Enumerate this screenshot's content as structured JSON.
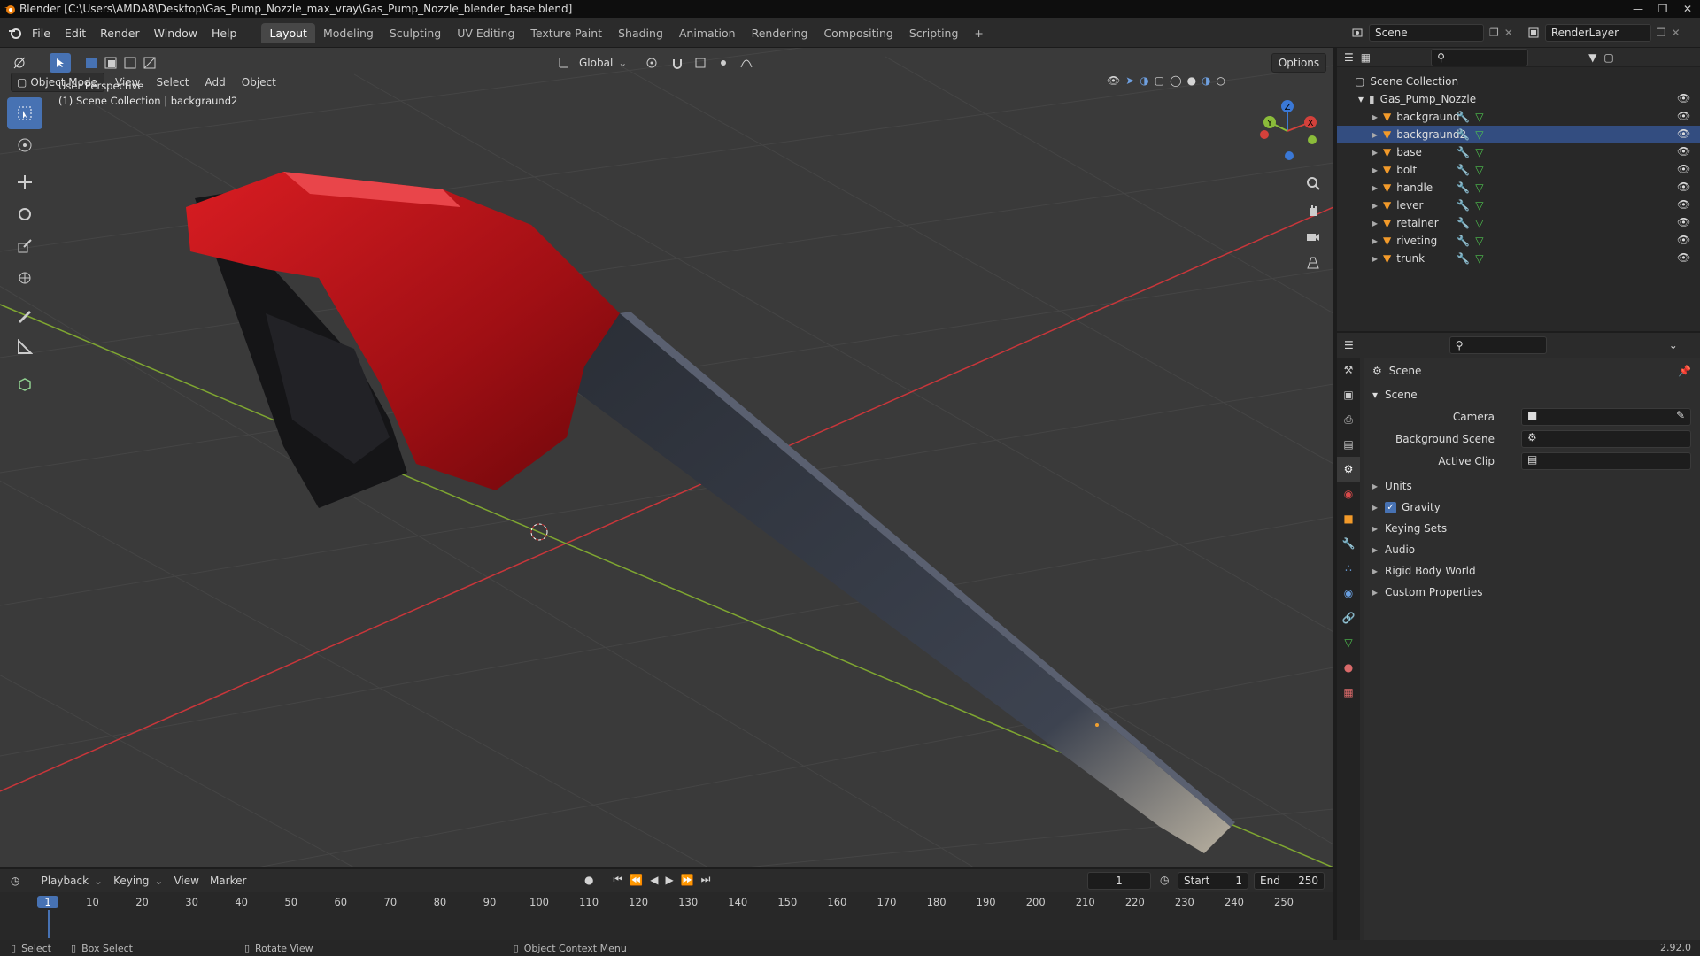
{
  "titlebar": {
    "title": "Blender [C:\\Users\\AMDA8\\Desktop\\Gas_Pump_Nozzle_max_vray\\Gas_Pump_Nozzle_blender_base.blend]"
  },
  "menu": [
    "File",
    "Edit",
    "Render",
    "Window",
    "Help"
  ],
  "workspaces": [
    "Layout",
    "Modeling",
    "Sculpting",
    "UV Editing",
    "Texture Paint",
    "Shading",
    "Animation",
    "Rendering",
    "Compositing",
    "Scripting"
  ],
  "active_workspace": "Layout",
  "topbar": {
    "orientation": "Global",
    "options": "Options"
  },
  "scene_selector": {
    "scene": "Scene",
    "view_layer": "RenderLayer"
  },
  "viewport": {
    "mode": "Object Mode",
    "menus": [
      "View",
      "Select",
      "Add",
      "Object"
    ],
    "overlay_text_1": "User Perspective",
    "overlay_text_2": "(1) Scene Collection | backgraund2",
    "gizmo": {
      "x": "X",
      "y": "Y",
      "z": "Z"
    }
  },
  "outliner": {
    "root": "Scene Collection",
    "collection": "Gas_Pump_Nozzle",
    "objects": [
      "backgraund",
      "backgraund2",
      "base",
      "bolt",
      "handle",
      "lever",
      "retainer",
      "riveting",
      "trunk"
    ],
    "selected": "backgraund2"
  },
  "properties": {
    "context": "Scene",
    "panel_title": "Scene",
    "fields": [
      {
        "label": "Camera"
      },
      {
        "label": "Background Scene"
      },
      {
        "label": "Active Clip"
      }
    ],
    "subpanels": [
      "Units",
      "Gravity",
      "Keying Sets",
      "Audio",
      "Rigid Body World",
      "Custom Properties"
    ],
    "gravity_checked": true
  },
  "timeline": {
    "menus": [
      "Playback",
      "Keying",
      "View",
      "Marker"
    ],
    "current_frame": "1",
    "start_label": "Start",
    "start": "1",
    "end_label": "End",
    "end": "250",
    "ticks": [
      "1",
      "10",
      "20",
      "30",
      "40",
      "50",
      "60",
      "70",
      "80",
      "90",
      "100",
      "110",
      "120",
      "130",
      "140",
      "150",
      "160",
      "170",
      "180",
      "190",
      "200",
      "210",
      "220",
      "230",
      "240",
      "250"
    ]
  },
  "statusbar": {
    "select": "Select",
    "box_select": "Box Select",
    "rotate": "Rotate View",
    "context_menu": "Object Context Menu",
    "version": "2.92.0"
  },
  "colors": {
    "accent": "#4772b3",
    "selected_row": "#334d80",
    "nozzle_red": "#c0141a",
    "axis_x": "#d3413b",
    "axis_y": "#8bbc3a",
    "axis_z": "#3a78d6"
  }
}
